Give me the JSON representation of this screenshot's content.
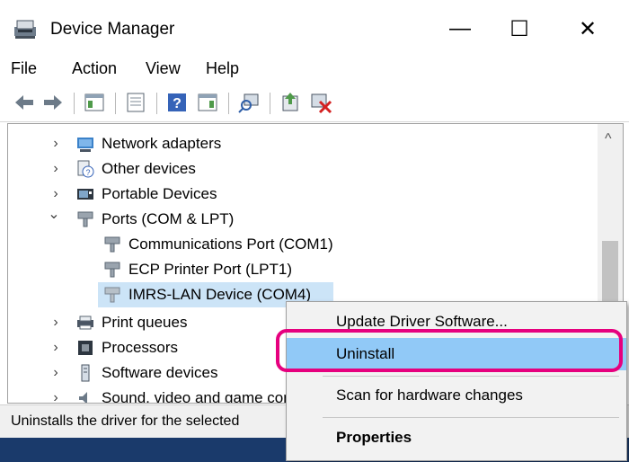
{
  "window": {
    "title": "Device Manager",
    "minimize_glyph": "—",
    "maximize_glyph": "☐",
    "close_glyph": "✕"
  },
  "menu": [
    "File",
    "Action",
    "View",
    "Help"
  ],
  "toolbar": {
    "icons": [
      "back-icon",
      "forward-icon",
      "show-hide-tree-icon",
      "properties-icon",
      "help-icon",
      "action-pane-icon",
      "scan-hardware-icon",
      "update-driver-icon",
      "uninstall-device-icon"
    ]
  },
  "tree": {
    "items": [
      {
        "label": "Network adapters",
        "icon": "network-adapter-icon",
        "chevron": "›"
      },
      {
        "label": "Other devices",
        "icon": "unknown-device-icon",
        "chevron": "›"
      },
      {
        "label": "Portable Devices",
        "icon": "portable-device-icon",
        "chevron": "›"
      },
      {
        "label": "Ports (COM & LPT)",
        "icon": "port-icon",
        "chevron": "⌄"
      },
      {
        "label": "Communications Port (COM1)",
        "icon": "port-icon"
      },
      {
        "label": "ECP Printer Port (LPT1)",
        "icon": "port-icon"
      },
      {
        "label": "IMRS-LAN Device (COM4)",
        "icon": "port-icon"
      },
      {
        "label": "Print queues",
        "icon": "printer-icon",
        "chevron": "›"
      },
      {
        "label": "Processors",
        "icon": "processor-icon",
        "chevron": "›"
      },
      {
        "label": "Software devices",
        "icon": "software-device-icon",
        "chevron": "›"
      },
      {
        "label": "Sound, video and game controllers",
        "icon": "sound-icon",
        "chevron": "›"
      }
    ],
    "scroll_up_glyph": "^"
  },
  "status": {
    "text": "Uninstalls the driver for the selected"
  },
  "context_menu": {
    "items": [
      {
        "label": "Update Driver Software..."
      },
      {
        "label": "Uninstall"
      },
      {
        "label": "Scan for hardware changes"
      },
      {
        "label": "Properties"
      }
    ]
  },
  "colors": {
    "selection": "#cce4f7",
    "highlight_ring": "#e6007e",
    "menu_hover": "#91c9f7"
  }
}
